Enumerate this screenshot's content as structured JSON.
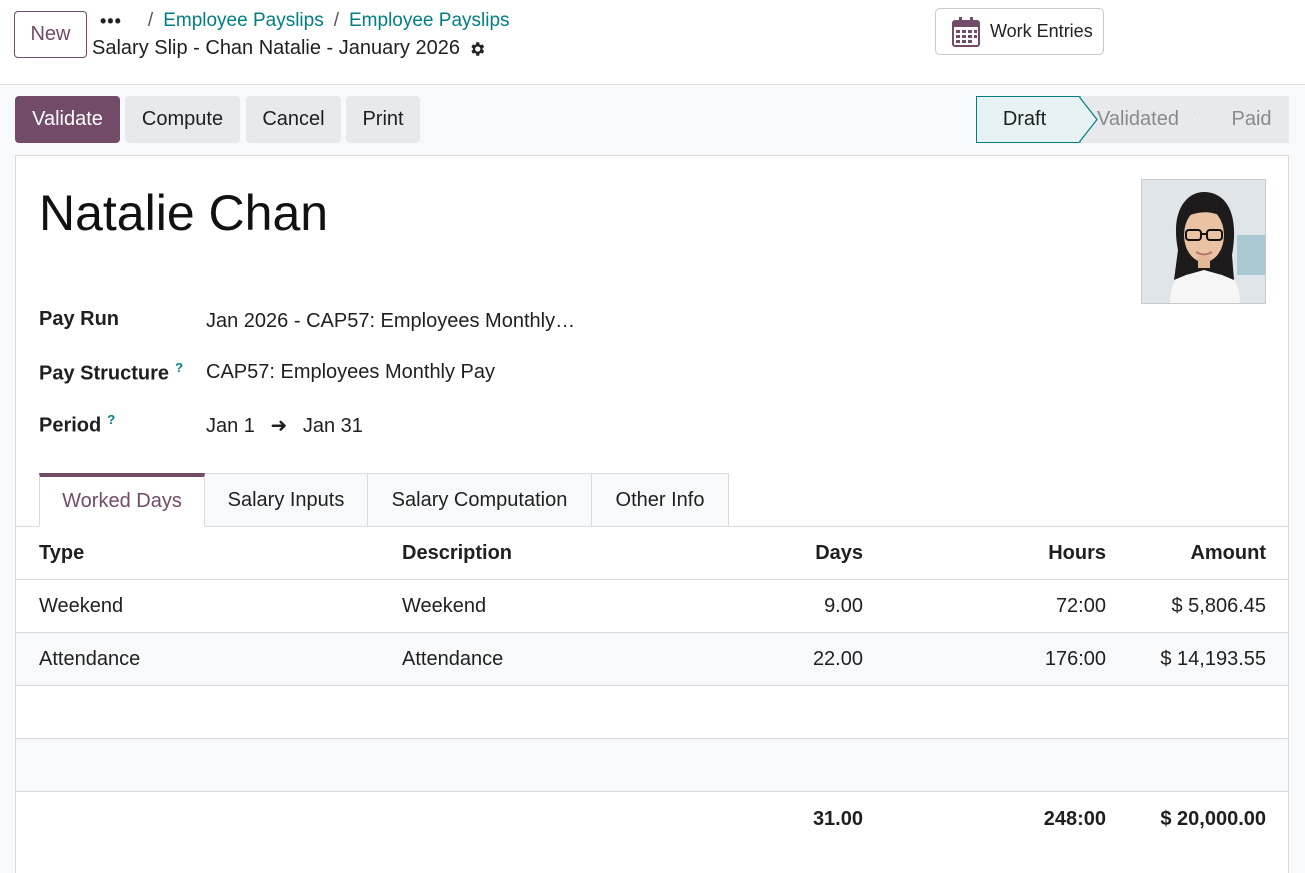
{
  "header": {
    "new_label": "New",
    "more_icon": "ellipsis-icon",
    "breadcrumbs": [
      "Employee Payslips",
      "Employee Payslips"
    ],
    "record_title": "Salary Slip - Chan Natalie - January 2026",
    "settings_icon": "gear-icon",
    "work_entries_label": "Work Entries"
  },
  "actions": {
    "validate": "Validate",
    "compute": "Compute",
    "cancel": "Cancel",
    "print": "Print"
  },
  "status": {
    "stages": [
      "Draft",
      "Validated",
      "Paid"
    ],
    "current": "Draft"
  },
  "form": {
    "employee_name": "Natalie Chan",
    "fields": {
      "pay_run_label": "Pay Run",
      "pay_run_value": "Jan 2026 - CAP57: Employees Monthly…",
      "pay_structure_label": "Pay Structure",
      "pay_structure_value": "CAP57: Employees Monthly Pay",
      "period_label": "Period",
      "period_from": "Jan 1",
      "period_to": "Jan 31",
      "help_mark": "?"
    },
    "tabs": [
      "Worked Days",
      "Salary Inputs",
      "Salary Computation",
      "Other Info"
    ],
    "active_tab": "Worked Days"
  },
  "worked_days": {
    "columns": [
      "Type",
      "Description",
      "Days",
      "Hours",
      "Amount"
    ],
    "rows": [
      {
        "type": "Weekend",
        "description": "Weekend",
        "days": "9.00",
        "hours": "72:00",
        "amount": "$ 5,806.45"
      },
      {
        "type": "Attendance",
        "description": "Attendance",
        "days": "22.00",
        "hours": "176:00",
        "amount": "$ 14,193.55"
      }
    ],
    "totals": {
      "days": "31.00",
      "hours": "248:00",
      "amount": "$ 20,000.00"
    }
  },
  "colors": {
    "brand": "#714b67",
    "link": "#017e84"
  }
}
